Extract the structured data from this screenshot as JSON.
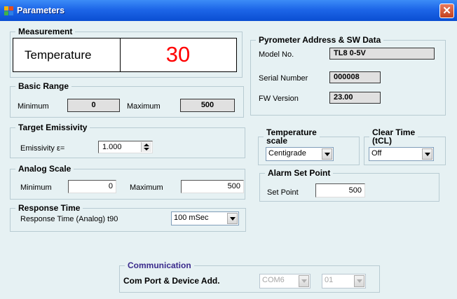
{
  "window": {
    "title": "Parameters",
    "close_glyph": "✕"
  },
  "measurement": {
    "legend": "Measurement",
    "name": "Temperature",
    "value": "30"
  },
  "basic_range": {
    "legend": "Basic Range",
    "min_label": "Minimum",
    "min_value": "0",
    "max_label": "Maximum",
    "max_value": "500"
  },
  "emissivity": {
    "legend": "Target Emissivity",
    "label": "Emissivity ε=",
    "value": "1.000"
  },
  "analog_scale": {
    "legend": "Analog Scale",
    "min_label": "Minimum",
    "min_value": "0",
    "max_label": "Maximum",
    "max_value": "500"
  },
  "response_time": {
    "legend": "Response Time",
    "label": "Response Time  (Analog)  t90",
    "value": "100 mSec"
  },
  "pyrometer": {
    "legend": "Pyrometer Address & SW Data",
    "model_label": "Model No.",
    "model_value": "TL8 0-5V",
    "serial_label": "Serial Number",
    "serial_value": "000008",
    "fw_label": "FW Version",
    "fw_value": "23.00"
  },
  "temp_scale": {
    "legend_line1": "Temperature",
    "legend_line2": "scale",
    "value": "Centigrade"
  },
  "clear_time": {
    "legend_line1": "Clear Time",
    "legend_line2": "(tCL)",
    "value": "Off"
  },
  "alarm": {
    "legend": "Alarm Set Point",
    "label": "Set Point",
    "value": "500"
  },
  "communication": {
    "legend": "Communication",
    "label": "Com Port & Device Add.",
    "port": "COM6",
    "address": "01"
  },
  "colors": {
    "measurement_value": "#ff0000",
    "communication_legend": "#3a2a8c",
    "title_bar": "#1d66e8"
  }
}
